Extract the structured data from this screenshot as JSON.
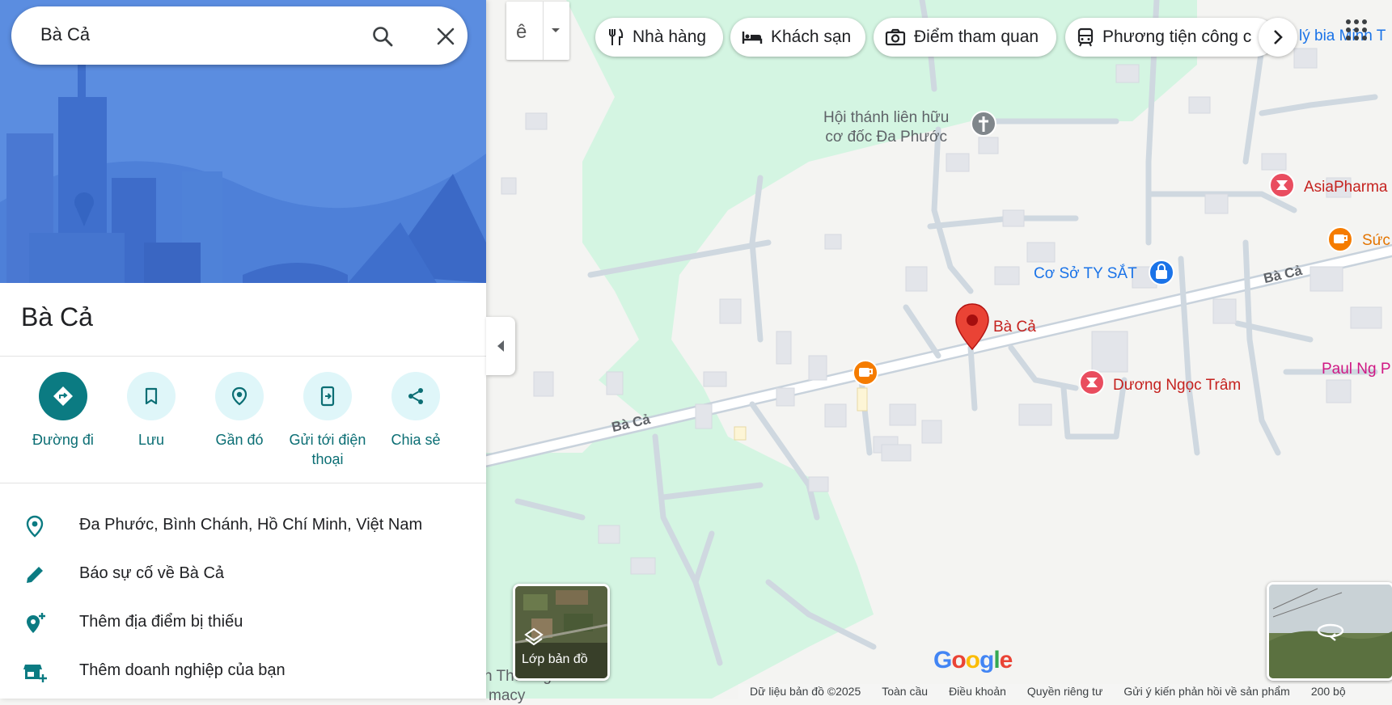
{
  "search": {
    "query": "Bà Cả"
  },
  "place": {
    "title": "Bà Cả"
  },
  "actions": [
    {
      "label": "Đường đi",
      "icon": "directions-icon"
    },
    {
      "label": "Lưu",
      "icon": "bookmark-icon"
    },
    {
      "label": "Gần đó",
      "icon": "nearby-icon"
    },
    {
      "label": "Gửi tới điện thoại",
      "icon": "send-to-phone-icon"
    },
    {
      "label": "Chia sẻ",
      "icon": "share-icon"
    }
  ],
  "info": [
    {
      "text": "Đa Phước, Bình Chánh, Hồ Chí Minh, Việt Nam",
      "icon": "location-pin-icon"
    },
    {
      "text": "Báo sự cố về Bà Cả",
      "icon": "pencil-icon"
    },
    {
      "text": "Thêm địa điểm bị thiếu",
      "icon": "add-place-icon"
    },
    {
      "text": "Thêm doanh nghiệp của bạn",
      "icon": "add-business-icon"
    }
  ],
  "ime": {
    "glyph": "ê"
  },
  "chips": [
    {
      "label": "Nhà hàng",
      "icon": "restaurant-icon"
    },
    {
      "label": "Khách sạn",
      "icon": "hotel-icon"
    },
    {
      "label": "Điểm tham quan",
      "icon": "camera-icon"
    },
    {
      "label": "Phương tiện công c",
      "icon": "transit-icon"
    }
  ],
  "map_labels": {
    "church_line1": "Hội thánh liên hữu",
    "church_line2": "cơ đốc Đa Phước",
    "asiapharma": "AsiaPharma",
    "suc": "Sức",
    "co_so": "Cơ Sở TY SẮT",
    "road_right": "Bà Cả",
    "pin_label": "Bà Cả",
    "duong_ngoc_tram": "Dương Ngọc Trâm",
    "paul": "Paul Ng P",
    "road_left": "Bà Cả",
    "ly_bia": "lý bia Minh T",
    "thuong": "h Thương",
    "macy": "macy"
  },
  "layers": {
    "label": "Lớp bản đồ"
  },
  "google_logo": "Google",
  "footer": {
    "copyright": "Dữ liệu bản đồ ©2025",
    "global": "Toàn cầu",
    "terms": "Điều khoản",
    "privacy": "Quyền riêng tư",
    "feedback": "Gửi ý kiến phản hồi về sản phẩm",
    "scale": "200 bộ"
  },
  "colors": {
    "accent": "#0b7b82",
    "pin": "#ea4335",
    "poi_text": "#c5221f",
    "shop": "#1a73e8",
    "cafe": "#f57c00",
    "green": "#d4f5e2"
  }
}
